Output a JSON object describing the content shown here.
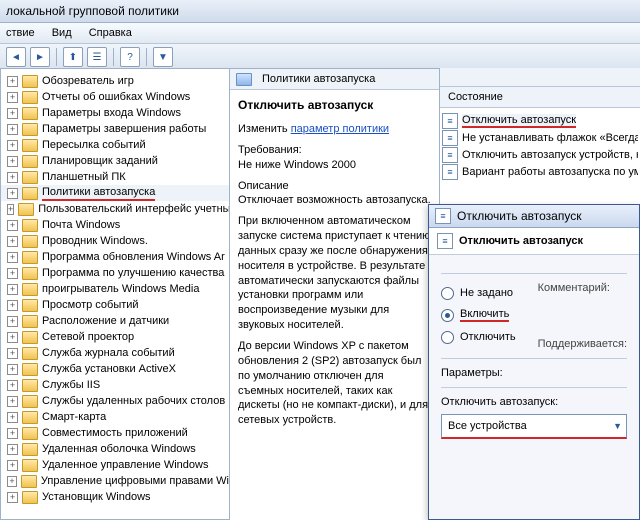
{
  "title": "локальной групповой политики",
  "menu": {
    "action": "ствие",
    "view": "Вид",
    "help": "Справка"
  },
  "toolbar_icons": [
    "back",
    "fwd",
    "up",
    "list",
    "help",
    "filter"
  ],
  "tree": [
    "Обозреватель игр",
    "Отчеты об ошибках Windows",
    "Параметры входа Windows",
    "Параметры завершения работы",
    "Пересылка событий",
    "Планировщик заданий",
    "Планшетный ПК",
    "Политики автозапуска",
    "Пользовательский интерфейс учетны",
    "Почта Windows",
    "Проводник Windows.",
    "Программа обновления Windows Ar",
    "Программа по улучшению качества",
    "проигрыватель Windows Media",
    "Просмотр событий",
    "Расположение и датчики",
    "Сетевой проектор",
    "Служба журнала событий",
    "Служба установки ActiveX",
    "Службы IIS",
    "Службы удаленных рабочих столов",
    "Смарт-карта",
    "Совместимость приложений",
    "Удаленная оболочка Windows",
    "Удаленное управление Windows",
    "Управление цифровыми правами Wi",
    "Установщик Windows"
  ],
  "tree_selected_index": 7,
  "mid": {
    "header": "Политики автозапуска",
    "title": "Отключить автозапуск",
    "edit_prefix": "Изменить ",
    "edit_link": "параметр политики",
    "req_label": "Требования:",
    "req_value": "Не ниже Windows 2000",
    "desc_label": "Описание",
    "desc_1": "Отключает возможность автозапуска.",
    "desc_2": "При включенном автоматическом запуске система приступает к чтению данных сразу же после обнаружения носителя в устройстве. В результате автоматически запускаются файлы установки программ или воспроизведение музыки для звуковых носителей.",
    "desc_3": "До версии Windows XP с пакетом обновления 2 (SP2) автозапуск был по умолчанию отключен для съемных носителей, таких как дискеты (но не компакт-диски), и для сетевых устройств."
  },
  "right": {
    "col_header": "Состояние",
    "items": [
      "Отключить автозапуск",
      "Не устанавливать флажок «Всегда вы",
      "Отключить автозапуск устройств, не",
      "Вариант работы автозапуска по умо."
    ],
    "selected_index": 0
  },
  "dialog": {
    "title": "Отключить автозапуск",
    "subtitle": "Отключить автозапуск",
    "opts": {
      "not_configured": "Не задано",
      "enabled": "Включить",
      "disabled": "Отключить"
    },
    "comment_label": "Комментарий:",
    "supported_label": "Поддерживается:",
    "params_header": "Параметры:",
    "field_label": "Отключить автозапуск:",
    "field_value": "Все устройства"
  }
}
